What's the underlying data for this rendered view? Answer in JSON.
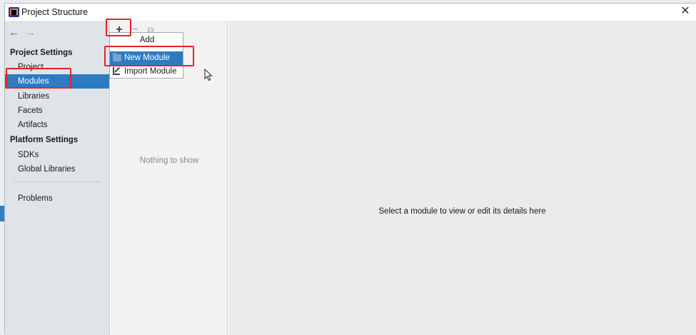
{
  "window": {
    "title": "Project Structure",
    "close_symbol": "✕"
  },
  "nav": {
    "back_symbol": "←",
    "forward_symbol": "→"
  },
  "sidebar": {
    "project_settings_label": "Project Settings",
    "platform_settings_label": "Platform Settings",
    "items": [
      {
        "label": "Project"
      },
      {
        "label": "Modules"
      },
      {
        "label": "Libraries"
      },
      {
        "label": "Facets"
      },
      {
        "label": "Artifacts"
      },
      {
        "label": "SDKs"
      },
      {
        "label": "Global Libraries"
      },
      {
        "label": "Problems"
      }
    ],
    "selected": "Modules"
  },
  "toolbar": {
    "add_symbol": "+",
    "remove_symbol": "−",
    "copy_symbol": "⧉"
  },
  "middle": {
    "empty_text": "Nothing to show"
  },
  "popup": {
    "title": "Add",
    "items": [
      {
        "label": "New Module",
        "icon": "folder-icon"
      },
      {
        "label": "Import Module",
        "icon": "import-icon"
      }
    ],
    "selected": "New Module"
  },
  "detail": {
    "message": "Select a module to view or edit its details here"
  },
  "colors": {
    "selection": "#2e7bc2",
    "highlight": "#e5242b"
  }
}
